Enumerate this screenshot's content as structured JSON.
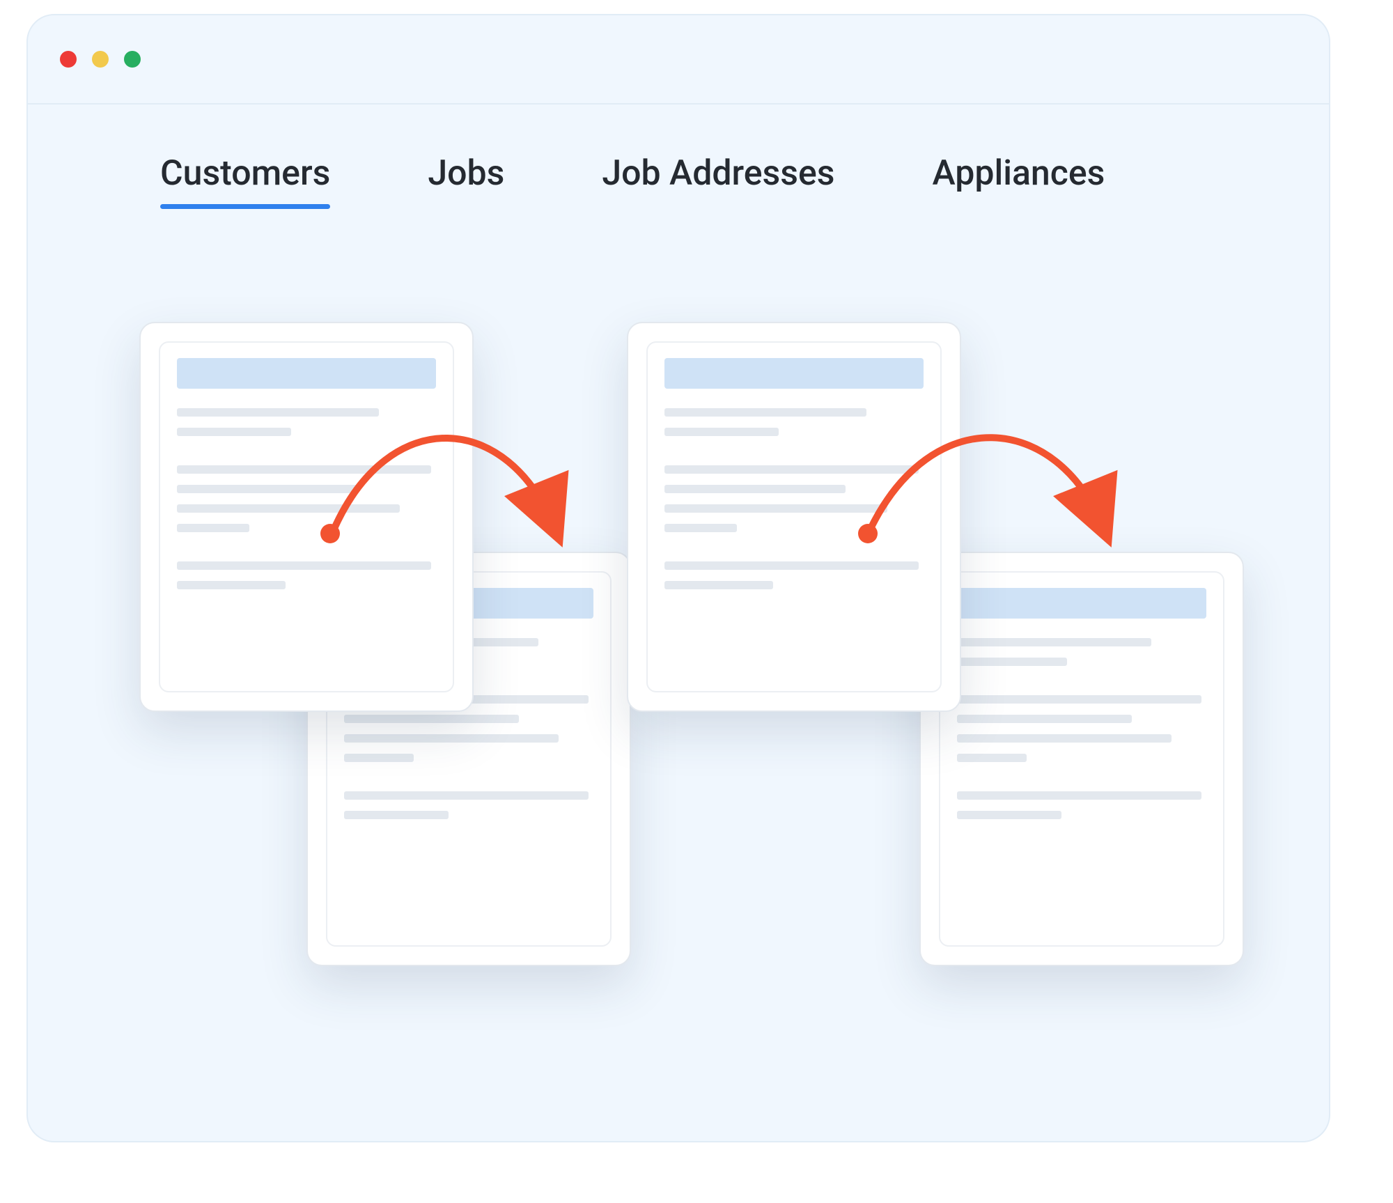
{
  "tabs": [
    {
      "label": "Customers",
      "active": true
    },
    {
      "label": "Jobs",
      "active": false
    },
    {
      "label": "Job Addresses",
      "active": false
    },
    {
      "label": "Appliances",
      "active": false
    }
  ],
  "window_controls": {
    "close_color": "#ED3A36",
    "minimize_color": "#F2C94C",
    "zoom_color": "#27AE60"
  },
  "accent_color": "#2F80ED",
  "arrow_color": "#F25330",
  "documents": [
    {
      "id": "doc-a",
      "role": "source"
    },
    {
      "id": "doc-b",
      "role": "target"
    },
    {
      "id": "doc-c",
      "role": "source"
    },
    {
      "id": "doc-d",
      "role": "target"
    }
  ]
}
